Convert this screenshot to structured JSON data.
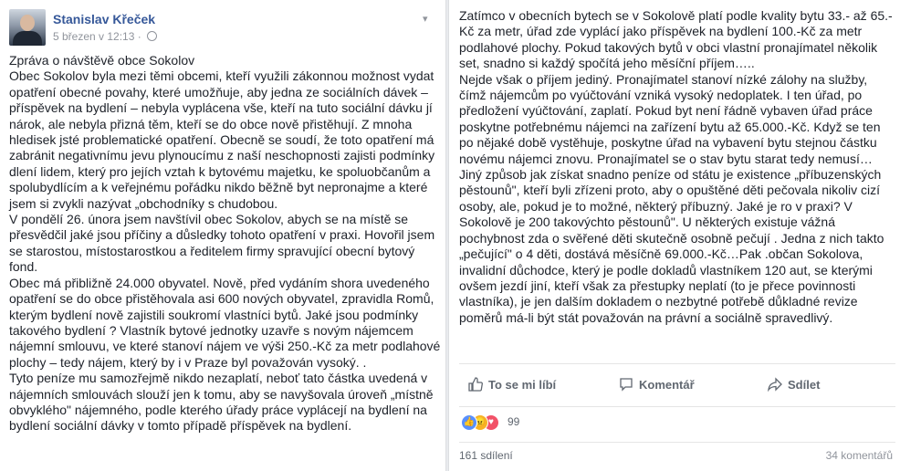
{
  "post": {
    "author": "Stanislav Křeček",
    "timestamp": "5 březen v 12:13",
    "separator": "·",
    "paragraphs_left": [
      "Zpráva o návštěvě obce Sokolov",
      "Obec Sokolov byla mezi těmi obcemi, kteří využili zákonnou možnost vydat opatření obecné povahy, které umožňuje, aby jedna ze sociálních dávek – příspěvek na bydlení – nebyla vyplácena vše, kteří na tuto sociální dávku jí nárok, ale nebyla přizná těm, kteří se do obce nově přistěhují. Z mnoha hledisek jsté problematické opatření. Obecně se soudí, že toto opatření má zabránit negativnímu jevu plynoucímu z naší neschopnosti zajisti podmínky dlení lidem, který pro jejích vztah k bytovému majetku, ke spoluobčanům a spolubydlícím a k veřejnému pořádku nikdo běžně byt nepronajme a které jsem si zvykli nazývat „obchodníky s chudobou.",
      "V pondělí 26. února jsem navštívil obec Sokolov, abych se na místě se přesvědčil jaké jsou příčiny a důsledky tohoto opatření v praxi. Hovořil jsem se starostou, místostarostkou a ředitelem firmy spravující obecní bytový fond.",
      "Obec má přibližně 24.000 obyvatel. Nově, před vydáním shora uvedeného opatření se do obce přistěhovala asi 600 nových obyvatel, zpravidla Romů, kterým bydlení nově zajistili soukromí vlastníci bytů. Jaké jsou podmínky takového bydlení ? Vlastník bytové jednotky uzavře s novým nájemcem nájemní smlouvu, ve které stanoví nájem ve výši 250.-Kč za metr podlahové plochy – tedy nájem, který by i v Praze byl považován vysoký. .",
      "Tyto peníze mu samozřejmě nikdo nezaplatí, neboť tato částka uvedená v nájemních smlouvách slouží jen k tomu, aby se navyšovala úroveň „místně obvyklého\" nájemného, podle kterého úřady práce vyplácejí na bydlení na bydlení sociální dávky v tomto případě příspěvek na bydlení."
    ],
    "paragraphs_right": [
      "Zatímco v obecních bytech se v Sokolově platí podle kvality bytu 33.- až 65.- Kč za metr, úřad zde vyplácí jako příspěvek na bydlení 100.-Kč za metr podlahové plochy. Pokud takových bytů v obci vlastní pronajímatel několik set, snadno si každý spočítá jeho měsíční příjem…..",
      "Nejde však o příjem jediný. Pronajímatel stanoví nízké zálohy na služby, čímž nájemcům po vyúčtování vzniká vysoký nedoplatek. I ten úřad, po předložení vyúčtování, zaplatí. Pokud byt není řádně vybaven úřad práce poskytne potřebnému nájemci na zařízení bytu až 65.000.-Kč. Když se ten po nějaké době vystěhuje, poskytne úřad na vybavení bytu stejnou částku novému nájemci znovu. Pronajímatel se o stav bytu starat tedy nemusí…",
      "Jiný způsob jak získat snadno peníze od státu je existence „příbuzenských pěstounů\", kteří byli zřízeni proto, aby o opuštěné děti pečovala nikoliv cizí osoby, ale, pokud je to možné, některý příbuzný. Jaké je ro v praxi? V Sokolově je 200 takovýchto pěstounů\". U některých existuje vážná pochybnost zda o svěřené děti skutečně osobně pečují . Jedna z nich takto „pečující\" o 4 děti, dostává měsíčně 69.000.-Kč…Pak .občan Sokolova, invalidní důchodce, který je podle dokladů vlastníkem 120 aut, se kterými ovšem jezdí jiní, kteří však za přestupky neplatí (to je přece povinnosti vlastníka), je jen dalším dokladem o nezbytné potřebě důkladné revize poměrů má-li být stát považován na právní a sociálně spravedlivý."
    ]
  },
  "actions": {
    "like": "To se mi líbí",
    "comment": "Komentář",
    "share": "Sdílet"
  },
  "stats": {
    "reaction_count": "99",
    "shares": "161 sdílení",
    "comments": "34 komentářů"
  },
  "colors": {
    "link": "#365899",
    "like_blue": "#5890ff",
    "angry": "#f7b125",
    "love": "#f25268"
  }
}
